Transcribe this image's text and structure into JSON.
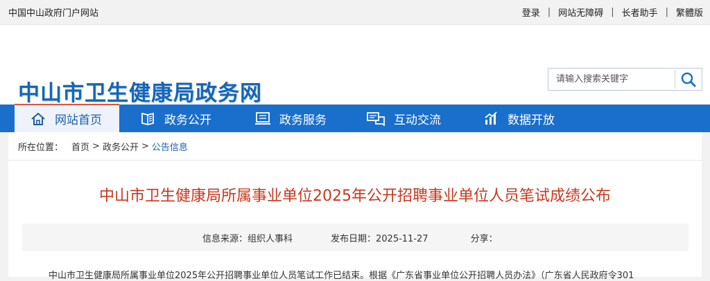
{
  "topbar": {
    "site_name": "中国中山政府门户网站",
    "links": [
      "登录",
      "网站无障碍",
      "长者助手",
      "繁體版"
    ]
  },
  "header": {
    "logo_text": "中山市卫生健康局政务网",
    "search_placeholder": "请输入搜索关键字"
  },
  "nav": {
    "items": [
      {
        "label": "网站首页",
        "icon": "home-icon"
      },
      {
        "label": "政务公开",
        "icon": "book-icon"
      },
      {
        "label": "政务服务",
        "icon": "service-icon"
      },
      {
        "label": "互动交流",
        "icon": "chat-icon"
      },
      {
        "label": "数据开放",
        "icon": "data-icon"
      }
    ]
  },
  "breadcrumb": {
    "prefix": "所在位置：",
    "items": [
      "首页",
      "政务公开",
      "公告信息"
    ]
  },
  "article": {
    "title": "中山市卫生健康局所属事业单位2025年公开招聘事业单位人员笔试成绩公布",
    "source_label": "信息来源：组织人事科",
    "date_label": "发布日期：2025-11-27",
    "share_label": "分享：",
    "body_first_line": "中山市卫生健康局所属事业单位2025年公开招聘事业单位人员笔试工作已结束。根据《广东省事业单位公开招聘人员办法》（广东省人民政府令301"
  },
  "colors": {
    "nav_bg": "#1a6fcc",
    "title_red": "#c9371d",
    "link_blue": "#1a5fb0"
  }
}
